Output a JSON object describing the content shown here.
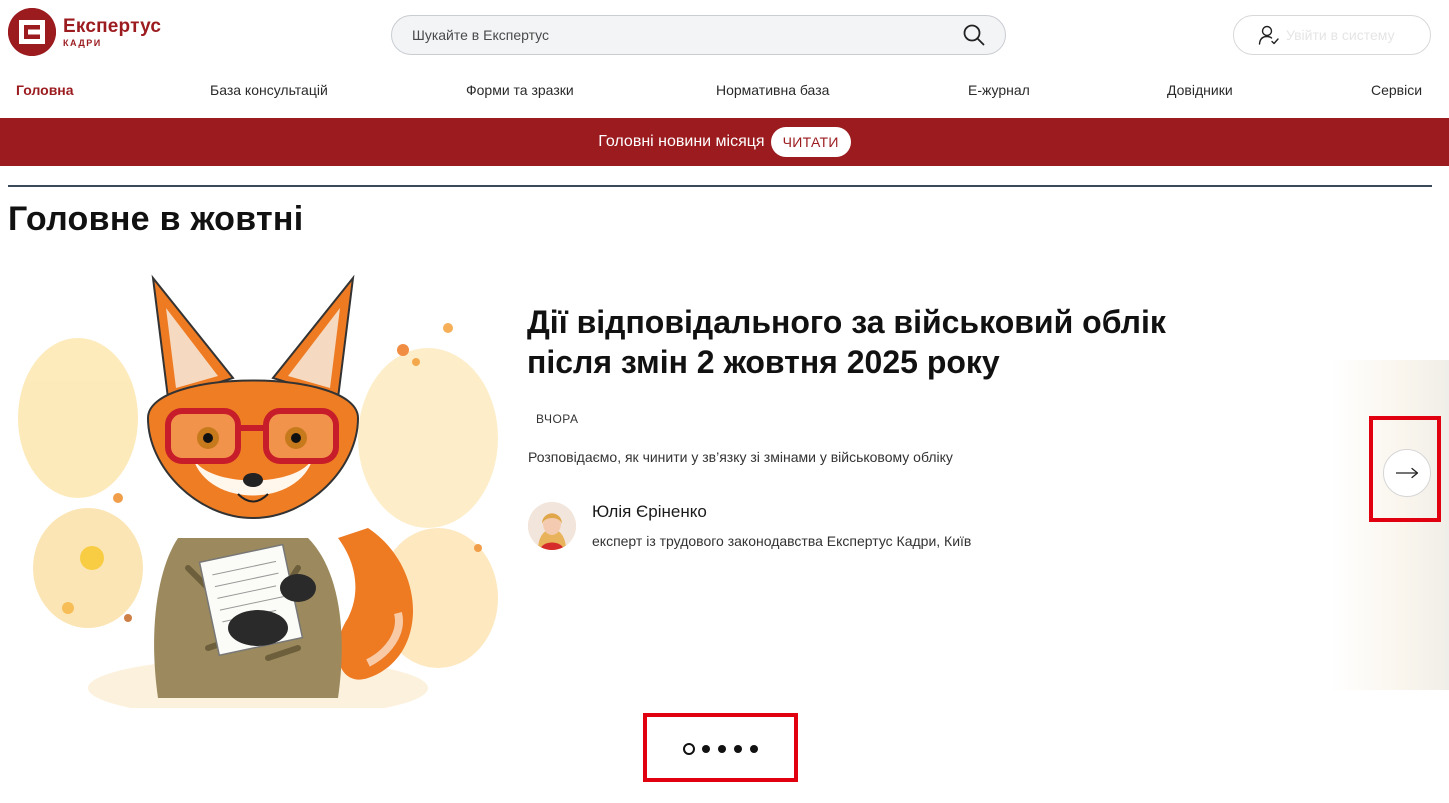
{
  "brand": {
    "name": "Експертус",
    "sub": "КАДРИ",
    "accent_color": "#9b1b1f"
  },
  "search": {
    "placeholder": "Шукайте в Експертус",
    "icon": "search-icon"
  },
  "login": {
    "label": "Увійти в систему",
    "icon": "user-check-icon"
  },
  "nav": {
    "items": [
      {
        "label": "Головна",
        "active": true
      },
      {
        "label": "База консультацій"
      },
      {
        "label": "Форми та зразки"
      },
      {
        "label": "Нормативна база"
      },
      {
        "label": "Е-журнал"
      },
      {
        "label": "Довідники"
      },
      {
        "label": "Сервіси"
      }
    ]
  },
  "banner": {
    "text": "Головні новини місяця",
    "button": "ЧИТАТИ"
  },
  "section": {
    "title": "Головне в жовтні"
  },
  "slide": {
    "title": "Дії відповідального за військовий облік після змін 2 жовтня 2025 року",
    "date": "ВЧОРА",
    "description": "Розповідаємо, як чинити у зв’язку зі змінами у військовому обліку",
    "author": {
      "name": "Юлія Єріненко",
      "role": "експерт із трудового законодавства Експертус Кадри, Київ"
    },
    "image": "fox-with-glasses-illustration"
  },
  "carousel": {
    "next_icon": "arrow-right-icon",
    "total_slides": 5,
    "active_index": 0
  },
  "highlight_color": "#e0000f"
}
